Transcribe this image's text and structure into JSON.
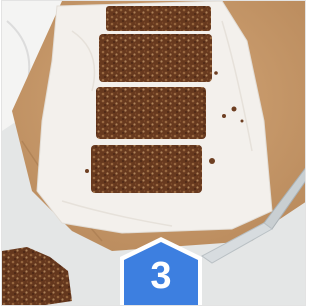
{
  "step_badge": {
    "number": "3",
    "color": "#3d7fe0",
    "shape": "hexagon"
  },
  "photo": {
    "colors": {
      "backdrop": "#e4e6e6",
      "cutting_board": "#c89a6b",
      "parchment": "#f3f0ec",
      "granola_bar": "#6e3f22",
      "knife_blade": "#c9cfd2"
    }
  }
}
